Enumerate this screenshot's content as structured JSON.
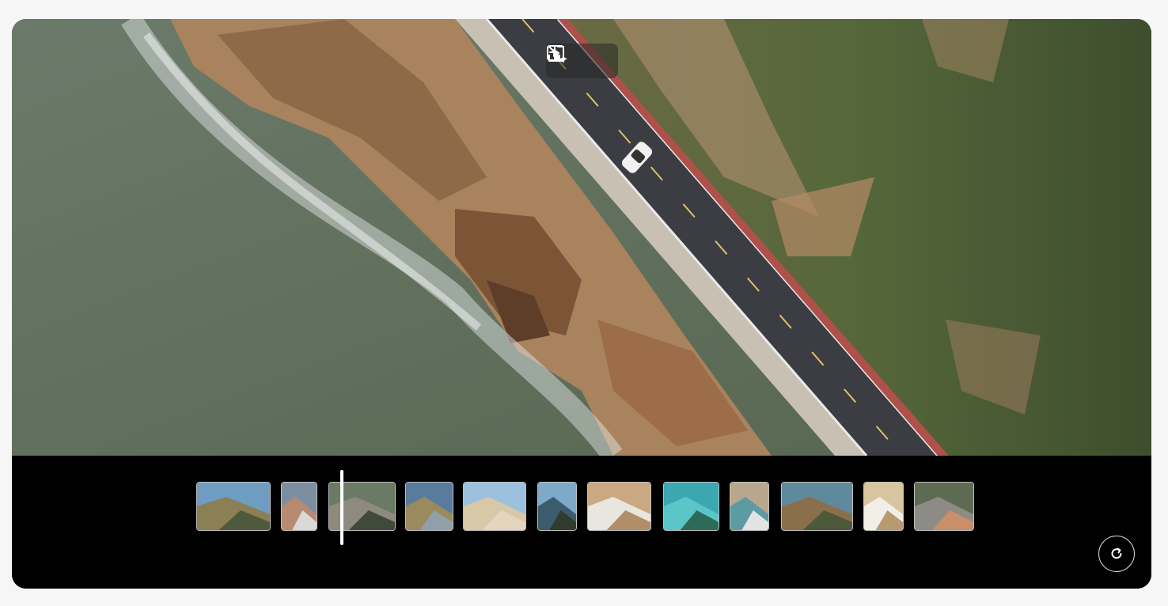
{
  "preview": {
    "image": "aerial-coastal-road-with-white-car"
  },
  "overlay_controls": [
    {
      "icon": "exit-fullscreen-icon"
    },
    {
      "icon": "ai-play-sparkle-icon"
    }
  ],
  "timeline": {
    "clips": [
      {
        "scene": "coastal-road-cliffs",
        "colors": [
          "#6f9dc2",
          "#8a7f55",
          "#4f5a3c"
        ]
      },
      {
        "scene": "rocky-shore-waves",
        "colors": [
          "#7b8fa1",
          "#b88a72",
          "#d9d9d9"
        ]
      },
      {
        "scene": "aerial-road-sea",
        "colors": [
          "#6a7a64",
          "#8e8a7e",
          "#3f4a3a"
        ]
      },
      {
        "scene": "hillside-coast",
        "colors": [
          "#5a7c9c",
          "#9a8a5e",
          "#8fa0a8"
        ]
      },
      {
        "scene": "beach-people",
        "colors": [
          "#9dc0de",
          "#d7c8a8",
          "#e4d6bd"
        ]
      },
      {
        "scene": "sea-horizon",
        "colors": [
          "#7fa9c8",
          "#3b5c6c",
          "#2f3b2c"
        ]
      },
      {
        "scene": "sand-waves-aerial",
        "colors": [
          "#c9a882",
          "#e9e6df",
          "#b08e68"
        ]
      },
      {
        "scene": "turquoise-island",
        "colors": [
          "#3aa7b1",
          "#5cc5c8",
          "#2c6b5a"
        ]
      },
      {
        "scene": "shoreline-foam",
        "colors": [
          "#b9a78d",
          "#5c9aa4",
          "#e1e4e2"
        ]
      },
      {
        "scene": "coastal-road-car",
        "colors": [
          "#5f8a9e",
          "#8a6f4c",
          "#4c5a3b"
        ]
      },
      {
        "scene": "beach-wave-edge",
        "colors": [
          "#d6c59e",
          "#f1efe8",
          "#b89a6e"
        ]
      },
      {
        "scene": "road-rocks-sea",
        "colors": [
          "#5c6b52",
          "#8d8b86",
          "#c98f68"
        ]
      }
    ],
    "refresh_icon": "refresh-icon"
  }
}
